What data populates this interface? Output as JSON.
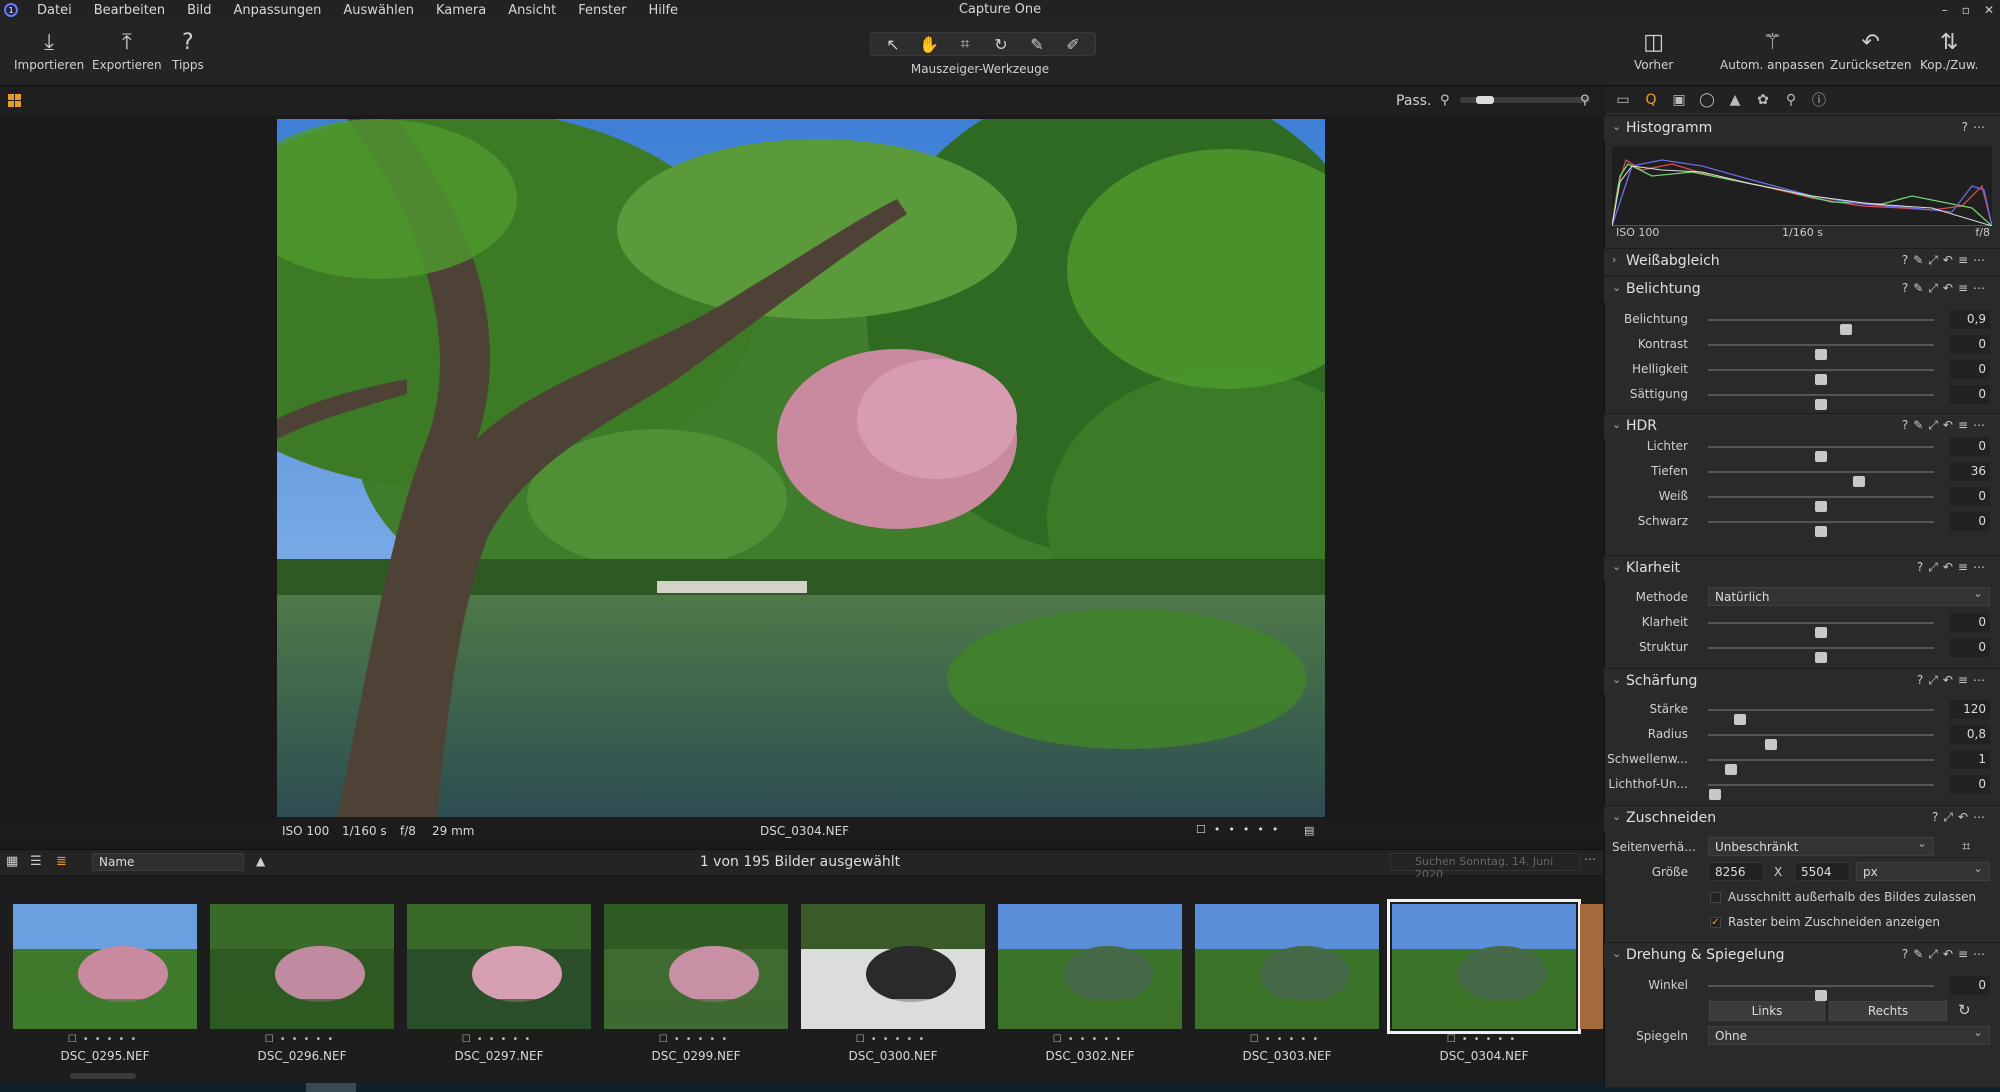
{
  "app": {
    "title": "Capture One",
    "menu": [
      "Datei",
      "Bearbeiten",
      "Bild",
      "Anpassungen",
      "Auswählen",
      "Kamera",
      "Ansicht",
      "Fenster",
      "Hilfe"
    ],
    "window_controls": [
      "–",
      "▫",
      "✕"
    ]
  },
  "toolbar": {
    "import": "Importieren",
    "export": "Exportieren",
    "tips": "Tipps",
    "cursor_tools_label": "Mauszeiger-Werkzeuge",
    "before": "Vorher",
    "auto_adjust": "Autom. anpassen",
    "reset": "Zurücksetzen",
    "copy_apply": "Kop./Zuw."
  },
  "viewer": {
    "zoom_label": "Pass.",
    "zoom_level": 0.12,
    "meta": {
      "iso": "ISO 100",
      "shutter": "1/160 s",
      "aperture": "f/8",
      "focal": "29 mm",
      "filename": "DSC_0304.NEF"
    }
  },
  "browser": {
    "sort": "Name",
    "selection": "1 von 195 Bilder ausgewählt",
    "search_placeholder": "Suchen Sonntag, 14. Juni 2020"
  },
  "thumbnails": [
    {
      "name": "DSC_0295.NEF"
    },
    {
      "name": "DSC_0296.NEF"
    },
    {
      "name": "DSC_0297.NEF"
    },
    {
      "name": "DSC_0299.NEF"
    },
    {
      "name": "DSC_0300.NEF"
    },
    {
      "name": "DSC_0302.NEF"
    },
    {
      "name": "DSC_0303.NEF"
    },
    {
      "name": "DSC_0304.NEF",
      "selected": true
    }
  ],
  "panel": {
    "histogram": {
      "title": "Histogramm",
      "iso": "ISO 100",
      "shutter": "1/160 s",
      "aperture": "f/8"
    },
    "white_balance": {
      "title": "Weißabgleich"
    },
    "exposure": {
      "title": "Belichtung",
      "sliders": [
        {
          "label": "Belichtung",
          "value": "0,9",
          "pos": 0.61
        },
        {
          "label": "Kontrast",
          "value": "0",
          "pos": 0.5
        },
        {
          "label": "Helligkeit",
          "value": "0",
          "pos": 0.5
        },
        {
          "label": "Sättigung",
          "value": "0",
          "pos": 0.5
        }
      ]
    },
    "hdr": {
      "title": "HDR",
      "sliders": [
        {
          "label": "Lichter",
          "value": "0",
          "pos": 0.5
        },
        {
          "label": "Tiefen",
          "value": "36",
          "pos": 0.67
        },
        {
          "label": "Weiß",
          "value": "0",
          "pos": 0.5
        },
        {
          "label": "Schwarz",
          "value": "0",
          "pos": 0.5
        }
      ]
    },
    "clarity": {
      "title": "Klarheit",
      "method_label": "Methode",
      "method": "Natürlich",
      "sliders": [
        {
          "label": "Klarheit",
          "value": "0",
          "pos": 0.5
        },
        {
          "label": "Struktur",
          "value": "0",
          "pos": 0.5
        }
      ]
    },
    "sharpening": {
      "title": "Schärfung",
      "sliders": [
        {
          "label": "Stärke",
          "value": "120",
          "pos": 0.14
        },
        {
          "label": "Radius",
          "value": "0,8",
          "pos": 0.28
        },
        {
          "label": "Schwellenw...",
          "value": "1",
          "pos": 0.1
        },
        {
          "label": "Lichthof-Un...",
          "value": "0",
          "pos": 0.03
        }
      ]
    },
    "crop": {
      "title": "Zuschneiden",
      "ratio_label": "Seitenverhä...",
      "ratio": "Unbeschränkt",
      "size_label": "Größe",
      "width": "8256",
      "x": "X",
      "height": "5504",
      "unit": "px",
      "opt1": "Ausschnitt außerhalb des Bildes zulassen",
      "opt2": "Raster beim Zuschneiden anzeigen"
    },
    "rotation": {
      "title": "Drehung & Spiegelung",
      "angle_label": "Winkel",
      "angle": "0",
      "angle_pos": 0.5,
      "left": "Links",
      "right": "Rechts",
      "flip_label": "Spiegeln",
      "flip": "Ohne"
    }
  }
}
